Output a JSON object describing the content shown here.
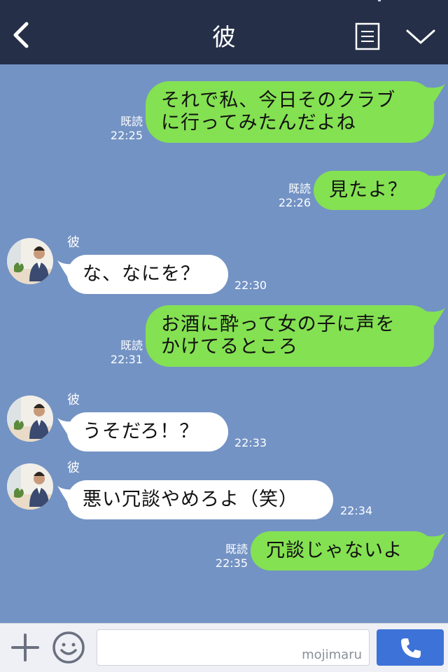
{
  "header": {
    "title": "彼"
  },
  "messages": [
    {
      "type": "sent",
      "text": "それで私、今日そのクラブ\nに行ってみたんだよね",
      "read": "既読",
      "time": "22:25"
    },
    {
      "type": "sent",
      "text": "見たよ？",
      "read": "既読",
      "time": "22:26"
    },
    {
      "type": "received",
      "sender": "彼",
      "text": "な、なにを？",
      "time": "22:30"
    },
    {
      "type": "sent",
      "text": "お酒に酔って女の子に声を\nかけてるところ",
      "read": "既読",
      "time": "22:31"
    },
    {
      "type": "received",
      "sender": "彼",
      "text": "うそだろ！？",
      "time": "22:33"
    },
    {
      "type": "received",
      "sender": "彼",
      "text": "悪い冗談やめろよ（笑）",
      "time": "22:34"
    },
    {
      "type": "sent",
      "text": "冗談じゃないよ",
      "read": "既読",
      "time": "22:35"
    }
  ],
  "footer": {
    "watermark": "mojimaru"
  },
  "icons": {
    "back": "back-arrow-icon",
    "menu": "memo-icon",
    "expand": "chevron-down-icon",
    "add": "plus-icon",
    "emoji": "smile-icon",
    "call": "phone-icon"
  },
  "colors": {
    "header_bg": "#252f48",
    "chat_bg": "#7393c4",
    "sent_bubble": "#84e152",
    "received_bubble": "#ffffff",
    "call_button": "#3d72d8"
  }
}
